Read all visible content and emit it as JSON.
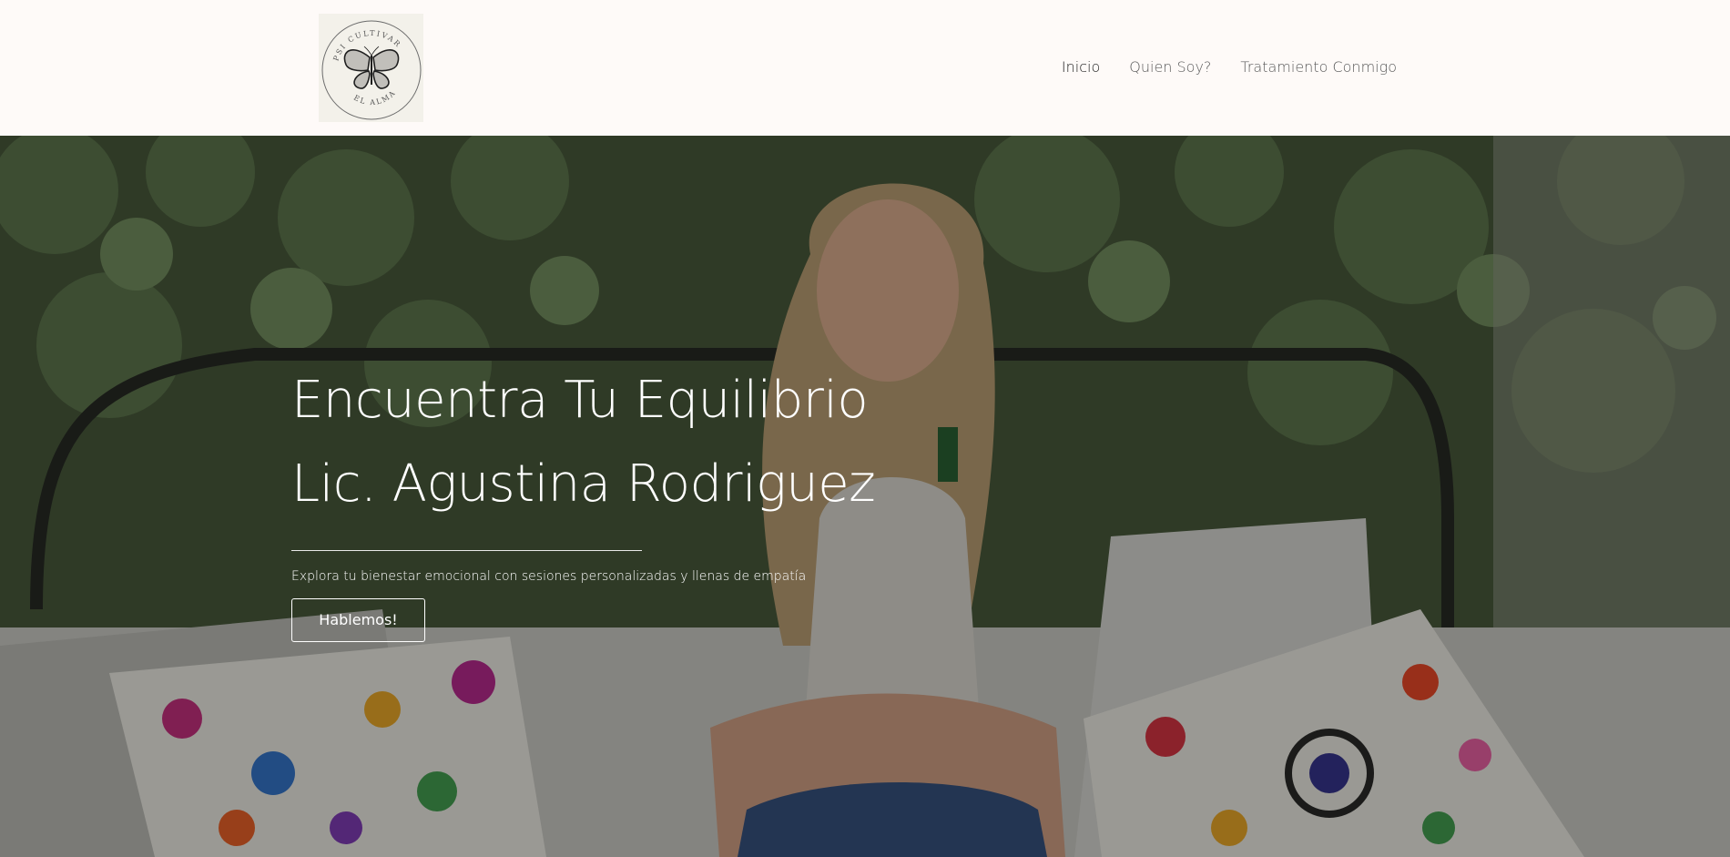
{
  "header": {
    "logo": {
      "top_text": "PSI CULTIVAR",
      "bottom_text": "EL ALMA",
      "icon": "butterfly-icon"
    },
    "nav": [
      {
        "label": "Inicio",
        "active": true
      },
      {
        "label": "Quien Soy?",
        "active": false
      },
      {
        "label": "Tratamiento Conmigo",
        "active": false
      }
    ]
  },
  "hero": {
    "title_line1": "Encuentra Tu Equilibrio",
    "title_line2": "Lic. Agustina Rodriguez",
    "subtitle": "Explora tu bienestar emocional con sesiones personalizadas y llenas de empatía",
    "cta_label": "Hablemos!"
  },
  "colors": {
    "header_bg": "#fefaf8",
    "nav_text": "#5b5b5b",
    "nav_active": "#222222",
    "hero_text": "#ffffff"
  }
}
